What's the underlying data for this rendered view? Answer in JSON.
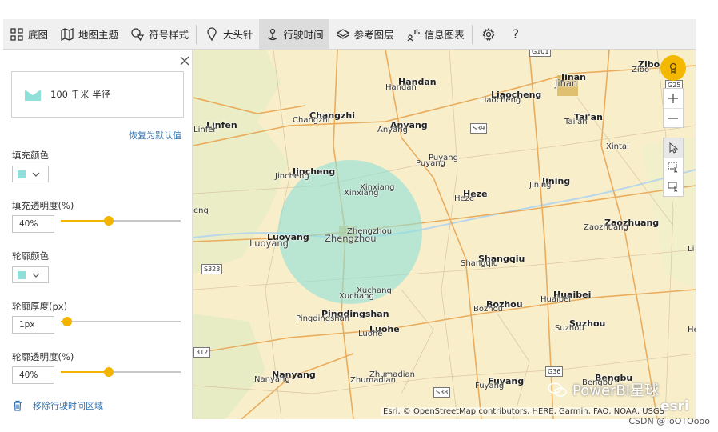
{
  "toolbar": {
    "items": [
      {
        "label": "底图"
      },
      {
        "label": "地图主题"
      },
      {
        "label": "符号样式"
      },
      {
        "label": "大头针"
      },
      {
        "label": "行驶时间"
      },
      {
        "label": "参考图层"
      },
      {
        "label": "信息图表"
      }
    ],
    "help": "?"
  },
  "panel": {
    "preview_text": "100 千米 半径",
    "reset_label": "恢复为默认值",
    "fill_color_label": "填充颜色",
    "fill_transparency_label": "填充透明度(%)",
    "fill_transparency_value": "40%",
    "fill_transparency_level": 0.4,
    "outline_color_label": "轮廓颜色",
    "outline_width_label": "轮廓厚度(px)",
    "outline_width_value": "1px",
    "outline_width_level": 0.05,
    "outline_transparency_label": "轮廓透明度(%)",
    "outline_transparency_value": "40%",
    "outline_transparency_level": 0.4,
    "remove_label": "移除行驶时间区域"
  },
  "colors": {
    "fill": "#8fe0d8",
    "accent": "#f2b400",
    "link": "#2c6fb0"
  },
  "map": {
    "cities": {
      "handan_en": "Handan",
      "handan_cn": "Handan",
      "liaocheng_en": "Liaocheng",
      "liaocheng_cn": "Liaocheng",
      "jinan_en": "Jinan",
      "jinan_cn": "Jinan",
      "zibo_en": "Zibo",
      "zibo_cn": "Zibo",
      "linfen_en": "Linfen",
      "linfen_cn": "Linfen",
      "changzhi_en": "Changzhi",
      "changzhi_cn": "Changzhi",
      "anyang_en": "Anyang",
      "anyang_cn": "Anyang",
      "taian_en": "Tai'an",
      "taian_cn": "Tai'an",
      "xintai": "Xintai",
      "puyang_en": "Puyang",
      "puyang_cn": "Puyang",
      "jincheng_en": "Jincheng",
      "jincheng_cn": "Jincheng",
      "xinxiang_en": "Xinxiang",
      "xinxiang_cn": "Xinxiang",
      "heze_en": "Heze",
      "heze_cn": "Heze",
      "jining_en": "Jining",
      "jining_cn": "Jining",
      "luoyang_en": "Luoyang",
      "luoyang_cn": "Luoyang",
      "zhengzhou_en": "Zhengzhou",
      "zhengzhou_cn": "Zhengzhou",
      "zaozhuang_en": "Zaozhuang",
      "zaozhuang_cn": "Zaozhuang",
      "shangqiu_en": "Shangqiu",
      "shangqiu_cn": "Shangqiu",
      "xuchang_en": "Xuchang",
      "xuchang_cn": "Xuchang",
      "huaibei_en": "Huaibei",
      "huaibei_cn": "Huaibei",
      "bozhou_en": "Bozhou",
      "bozhou_cn": "Bozhou",
      "pingdingshan_en": "Pingdingshan",
      "pingdingshan_cn": "Pingdingshan",
      "luohe_en": "Luohe",
      "luohe_cn": "Luohe",
      "suzhou_en": "Suzhou",
      "suzhou_cn": "Suzhou",
      "nanyang_en": "Nanyang",
      "nanyang_cn": "Nanyang",
      "zhumadian_en": "Zhumadian",
      "zhumadian_cn": "Zhumadian",
      "fuyang_en": "Fuyang",
      "fuyang_cn": "Fuyang",
      "bengbu_en": "Bengbu",
      "bengbu_cn": "Bengbu",
      "eng": "eng",
      "li": "Li",
      "he": "He"
    },
    "shields": {
      "s39": "S39",
      "s323": "S323",
      "s38": "S38",
      "g36": "G36",
      "g25": "G25",
      "g101": "G101",
      "s312": "312"
    },
    "attribution": "Esri, © OpenStreetMap contributors, HERE, Garmin, FAO, NOAA, USGS",
    "esri": "esri"
  },
  "watermark": {
    "text": "PowerBI星球",
    "csdn": "CSDN @ToOTOooo"
  }
}
